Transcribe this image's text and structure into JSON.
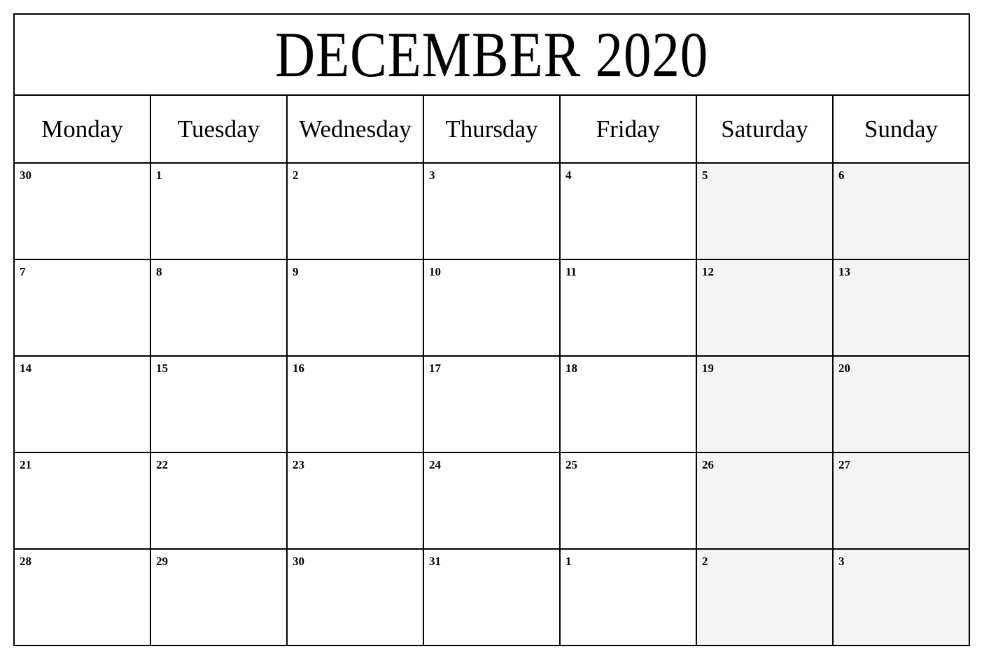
{
  "document": {
    "type": "monthly-calendar",
    "title": "DECEMBER 2020",
    "month": "December",
    "year": "2020",
    "week_start": "Monday"
  },
  "colors": {
    "page_background": "#ffffff",
    "grid_line": "#000000",
    "text": "#000000",
    "weekend_cell_fill": "#f4f4f4"
  },
  "weekdays": [
    {
      "label": "Monday",
      "weekend": false
    },
    {
      "label": "Tuesday",
      "weekend": false
    },
    {
      "label": "Wednesday",
      "weekend": false
    },
    {
      "label": "Thursday",
      "weekend": false
    },
    {
      "label": "Friday",
      "weekend": false
    },
    {
      "label": "Saturday",
      "weekend": true
    },
    {
      "label": "Sunday",
      "weekend": true
    }
  ],
  "weeks": [
    {
      "days": [
        {
          "number": "30",
          "in_month": false,
          "weekend": false
        },
        {
          "number": "1",
          "in_month": true,
          "weekend": false
        },
        {
          "number": "2",
          "in_month": true,
          "weekend": false
        },
        {
          "number": "3",
          "in_month": true,
          "weekend": false
        },
        {
          "number": "4",
          "in_month": true,
          "weekend": false
        },
        {
          "number": "5",
          "in_month": true,
          "weekend": true
        },
        {
          "number": "6",
          "in_month": true,
          "weekend": true
        }
      ]
    },
    {
      "days": [
        {
          "number": "7",
          "in_month": true,
          "weekend": false
        },
        {
          "number": "8",
          "in_month": true,
          "weekend": false
        },
        {
          "number": "9",
          "in_month": true,
          "weekend": false
        },
        {
          "number": "10",
          "in_month": true,
          "weekend": false
        },
        {
          "number": "11",
          "in_month": true,
          "weekend": false
        },
        {
          "number": "12",
          "in_month": true,
          "weekend": true
        },
        {
          "number": "13",
          "in_month": true,
          "weekend": true
        }
      ]
    },
    {
      "days": [
        {
          "number": "14",
          "in_month": true,
          "weekend": false
        },
        {
          "number": "15",
          "in_month": true,
          "weekend": false
        },
        {
          "number": "16",
          "in_month": true,
          "weekend": false
        },
        {
          "number": "17",
          "in_month": true,
          "weekend": false
        },
        {
          "number": "18",
          "in_month": true,
          "weekend": false
        },
        {
          "number": "19",
          "in_month": true,
          "weekend": true
        },
        {
          "number": "20",
          "in_month": true,
          "weekend": true
        }
      ]
    },
    {
      "days": [
        {
          "number": "21",
          "in_month": true,
          "weekend": false
        },
        {
          "number": "22",
          "in_month": true,
          "weekend": false
        },
        {
          "number": "23",
          "in_month": true,
          "weekend": false
        },
        {
          "number": "24",
          "in_month": true,
          "weekend": false
        },
        {
          "number": "25",
          "in_month": true,
          "weekend": false
        },
        {
          "number": "26",
          "in_month": true,
          "weekend": true
        },
        {
          "number": "27",
          "in_month": true,
          "weekend": true
        }
      ]
    },
    {
      "days": [
        {
          "number": "28",
          "in_month": true,
          "weekend": false
        },
        {
          "number": "29",
          "in_month": true,
          "weekend": false
        },
        {
          "number": "30",
          "in_month": true,
          "weekend": false
        },
        {
          "number": "31",
          "in_month": true,
          "weekend": false
        },
        {
          "number": "1",
          "in_month": false,
          "weekend": false
        },
        {
          "number": "2",
          "in_month": false,
          "weekend": true
        },
        {
          "number": "3",
          "in_month": false,
          "weekend": true
        }
      ]
    }
  ]
}
